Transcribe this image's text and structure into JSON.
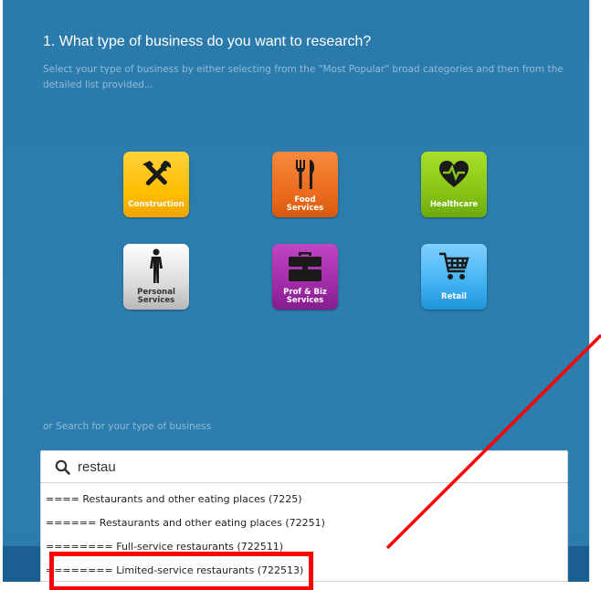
{
  "section": {
    "title": "1. What type of business do you want to research?",
    "subtitle": "Select your type of business by either selecting from the \"Most Popular\" broad categories and then from the detailed list provided..."
  },
  "categories": [
    {
      "id": "construction",
      "label": "Construction",
      "icon": "tools-icon",
      "color": "#ffc20e"
    },
    {
      "id": "food",
      "label": "Food\nServices",
      "icon": "fork-knife-icon",
      "color": "#ee6d22"
    },
    {
      "id": "healthcare",
      "label": "Healthcare",
      "icon": "heart-pulse-icon",
      "color": "#8cc617"
    },
    {
      "id": "personal",
      "label": "Personal\nServices",
      "icon": "person-icon",
      "color": "#d4d4d4"
    },
    {
      "id": "profbiz",
      "label": "Prof & Biz\nServices",
      "icon": "briefcase-icon",
      "color": "#a22ea9"
    },
    {
      "id": "retail",
      "label": "Retail",
      "icon": "shopping-cart-icon",
      "color": "#3aaeef"
    }
  ],
  "search": {
    "hint": "or Search for your type of business",
    "value": "restau"
  },
  "results": [
    "==== Restaurants and other eating places (7225)",
    "====== Restaurants and other eating places (72251)",
    "======== Full-service restaurants (722511)",
    "======== Limited-service restaurants (722513)"
  ],
  "annotation": {
    "color": "#ff0000"
  }
}
